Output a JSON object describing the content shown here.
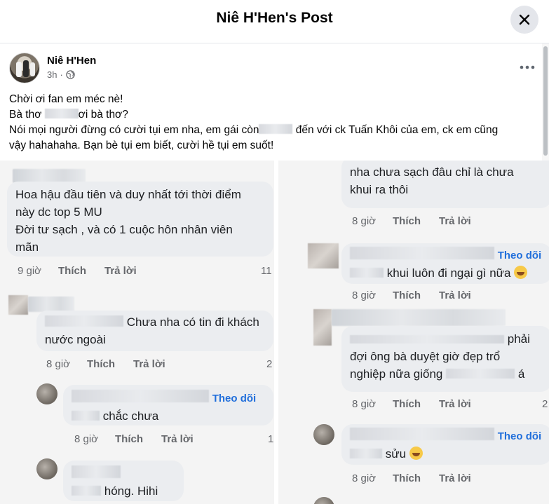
{
  "header": {
    "title": "Niê H'Hen's Post"
  },
  "post": {
    "author": "Niê H'Hen",
    "time": "3h",
    "lines": [
      "Chời ơi fan em méc nè!",
      [
        "Bà thơ",
        "ơi bà thơ?"
      ],
      [
        "Nói mọi người đừng có cười tụi em nha, em gái còn",
        "đến với ck Tuấn Khôi của em, ck em cũng"
      ],
      "vậy hahahaha. Bạn bè tụi em biết, cười hề tụi em suốt!"
    ]
  },
  "left_comments": [
    {
      "lines": [
        "Hoa hậu đầu tiên và duy nhất tới thời điểm",
        "này dc top 5 MU",
        "Đời tư sạch , và có 1 cuộc hôn nhân viên",
        "mãn"
      ],
      "time": "9 giờ",
      "like": "Thích",
      "reply": "Trả lời",
      "count": "11"
    },
    {
      "lines": [
        "Chưa nha có tin đi khách",
        "nước ngoài"
      ],
      "time": "8 giờ",
      "like": "Thích",
      "reply": "Trả lời",
      "count": "2"
    },
    {
      "follow": "Theo dõi",
      "lines": [
        "chắc chưa"
      ],
      "time": "8 giờ",
      "like": "Thích",
      "reply": "Trả lời",
      "count": "1"
    },
    {
      "lines": [
        "hóng. Hihi"
      ]
    }
  ],
  "right_comments": [
    {
      "lines": [
        "nha chưa sạch đâu chỉ là chưa",
        "khui ra thôi"
      ],
      "time": "8 giờ",
      "like": "Thích",
      "reply": "Trả lời"
    },
    {
      "follow": "Theo dõi",
      "lines": [
        "khui luôn đi ngại gì nữa"
      ],
      "time": "8 giờ",
      "like": "Thích",
      "reply": "Trả lời"
    },
    {
      "lines": [
        "phải",
        "đợi ông bà duyệt giờ đẹp trổ",
        "nghiệp nữa giống",
        "á"
      ],
      "time": "8 giờ",
      "like": "Thích",
      "reply": "Trả lời",
      "count": "2"
    },
    {
      "follow": "Theo dõi",
      "lines": [
        "sửu"
      ],
      "time": "8 giờ",
      "like": "Thích",
      "reply": "Trả lời"
    }
  ],
  "icons": {
    "close": "close-icon",
    "more": "more-horizontal-icon",
    "privacy": "globe-icon",
    "emoji": "grinning-face-icon"
  },
  "colors": {
    "link_blue": "#216fdb",
    "meta_gray": "#65676b",
    "bubble": "#ebedf0"
  }
}
